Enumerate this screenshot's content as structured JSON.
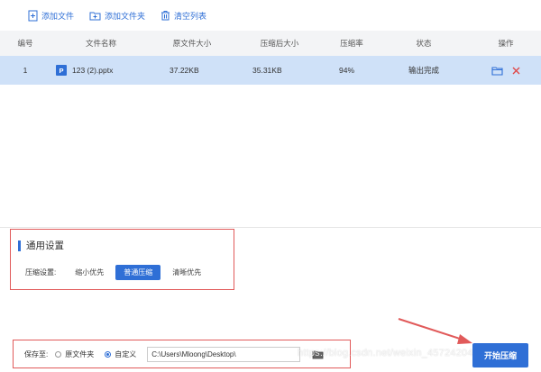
{
  "toolbar": {
    "add_file": "添加文件",
    "add_folder": "添加文件夹",
    "clear_list": "清空列表"
  },
  "table": {
    "headers": [
      "编号",
      "文件名称",
      "原文件大小",
      "压缩后大小",
      "压缩率",
      "状态",
      "操作"
    ],
    "rows": [
      {
        "no": "1",
        "badge": "P",
        "name": "123 (2).pptx",
        "orig": "37.22KB",
        "comp": "35.31KB",
        "rate": "94%",
        "status": "输出完成"
      }
    ]
  },
  "settings": {
    "title": "通用设置",
    "compress_label": "压缩设置:",
    "options": [
      "缩小优先",
      "普通压缩",
      "清晰优先"
    ],
    "selected": "普通压缩"
  },
  "save": {
    "label": "保存至:",
    "option_original": "原文件夹",
    "option_custom": "自定义",
    "path": "C:\\Users\\Mloong\\Desktop\\"
  },
  "start_button": "开始压缩",
  "watermark": "https://blog.csdn.net/weixin_45724204",
  "colors": {
    "accent": "#2f6fd6",
    "highlight_row": "#cfe1f8",
    "annotation": "#e15a5a",
    "delete": "#e04848"
  }
}
